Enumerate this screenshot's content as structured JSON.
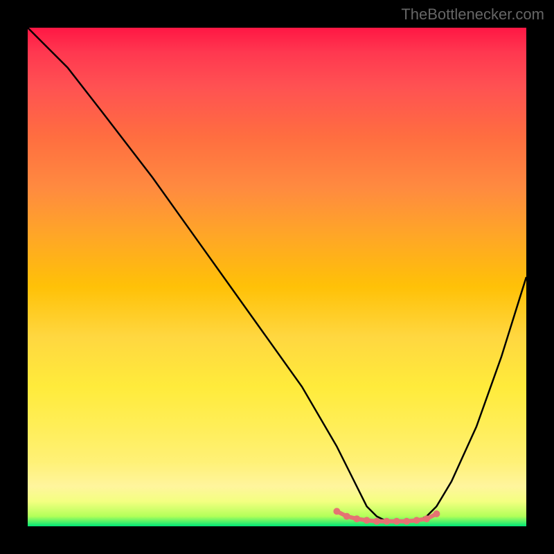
{
  "watermark": "TheBottleneсker.com",
  "chart_data": {
    "type": "line",
    "title": "",
    "xlabel": "",
    "ylabel": "",
    "xlim": [
      0,
      100
    ],
    "ylim": [
      0,
      100
    ],
    "series": [
      {
        "name": "main-curve",
        "x": [
          0,
          3,
          8,
          15,
          25,
          35,
          45,
          55,
          62,
          66,
          68,
          70,
          72,
          74,
          76,
          78,
          80,
          82,
          85,
          90,
          95,
          100
        ],
        "values": [
          100,
          97,
          92,
          83,
          70,
          56,
          42,
          28,
          16,
          8,
          4,
          2,
          1,
          1,
          1,
          1,
          2,
          4,
          9,
          20,
          34,
          50
        ]
      },
      {
        "name": "highlight-points",
        "x": [
          62,
          64,
          66,
          68,
          70,
          72,
          74,
          76,
          78,
          80,
          82
        ],
        "values": [
          3,
          2,
          1.5,
          1.2,
          1,
          1,
          1,
          1,
          1.2,
          1.5,
          2.5
        ]
      }
    ],
    "colors": {
      "curve": "#000000",
      "highlight": "#e57373",
      "gradient_top": "#ff1744",
      "gradient_bottom": "#00e676"
    }
  }
}
